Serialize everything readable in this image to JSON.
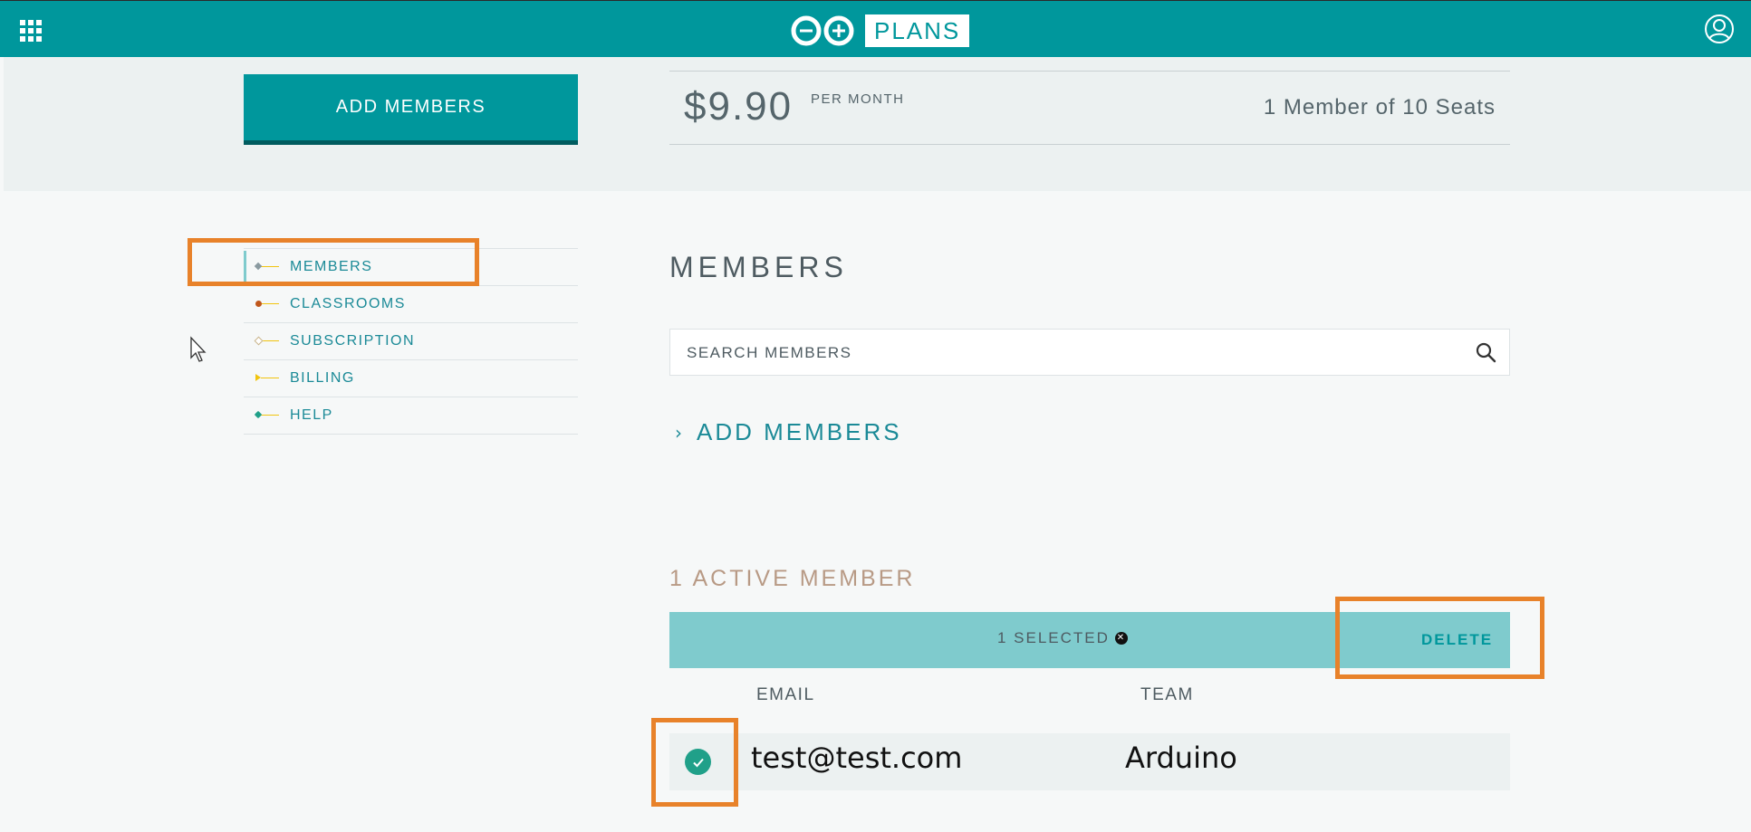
{
  "header": {
    "logo_text": "PLANS",
    "apps_icon": "apps-grid-icon",
    "user_icon": "user-account-icon"
  },
  "summary": {
    "add_members_button": "ADD MEMBERS",
    "price": "$9.90",
    "price_period": "PER MONTH",
    "seats": "1 Member of 10 Seats"
  },
  "sidebar": {
    "items": [
      {
        "label": "MEMBERS",
        "color": "#8a9aa0",
        "active": true
      },
      {
        "label": "CLASSROOMS",
        "color": "#c0571b",
        "active": false
      },
      {
        "label": "SUBSCRIPTION",
        "color": "#c8b38a",
        "active": false
      },
      {
        "label": "BILLING",
        "color": "#f1c40f",
        "active": false
      },
      {
        "label": "HELP",
        "color": "#20a089",
        "active": false
      }
    ]
  },
  "main": {
    "title": "MEMBERS",
    "search_placeholder": "SEARCH MEMBERS",
    "add_members_link": "ADD MEMBERS",
    "active_count": "1 ACTIVE MEMBER",
    "selection": {
      "label": "1 SELECTED",
      "delete_label": "DELETE"
    },
    "table": {
      "columns": [
        "EMAIL",
        "TEAM"
      ],
      "rows": [
        {
          "email": "test@test.com",
          "team": "Arduino",
          "selected": true
        }
      ]
    }
  },
  "colors": {
    "brand": "#00979c",
    "highlight": "#e8822a",
    "selection_bar": "#7fcbcd",
    "check": "#20a089"
  }
}
